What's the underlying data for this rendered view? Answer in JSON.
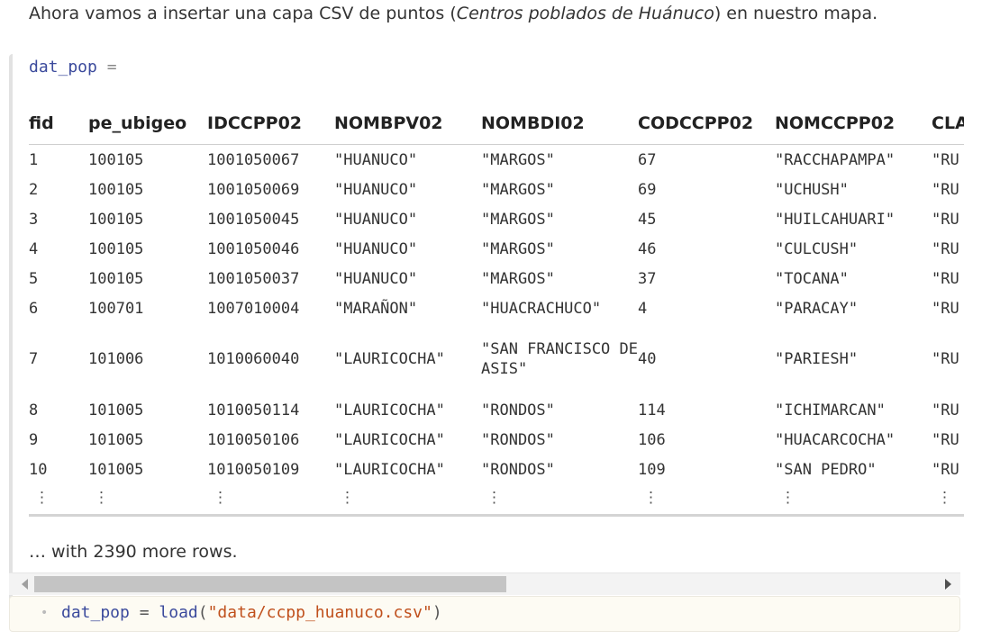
{
  "intro": {
    "before": "Ahora vamos a insertar una capa CSV de puntos (",
    "emph": "Centros poblados de Huánuco",
    "after": ") en nuestro mapa."
  },
  "cell": {
    "variable": "dat_pop",
    "operator": "="
  },
  "table": {
    "headers": [
      "fid",
      "pe_ubigeo",
      "IDCCPP02",
      "NOMBPV02",
      "NOMBDI02",
      "CODCCPP02",
      "NOMCCPP02",
      "CLA"
    ],
    "rows": [
      [
        "1",
        "100105",
        "1001050067",
        "\"HUANUCO\"",
        "\"MARGOS\"",
        "67",
        "\"RACCHAPAMPA\"",
        "\"RU"
      ],
      [
        "2",
        "100105",
        "1001050069",
        "\"HUANUCO\"",
        "\"MARGOS\"",
        "69",
        "\"UCHUSH\"",
        "\"RU"
      ],
      [
        "3",
        "100105",
        "1001050045",
        "\"HUANUCO\"",
        "\"MARGOS\"",
        "45",
        "\"HUILCAHUARI\"",
        "\"RU"
      ],
      [
        "4",
        "100105",
        "1001050046",
        "\"HUANUCO\"",
        "\"MARGOS\"",
        "46",
        "\"CULCUSH\"",
        "\"RU"
      ],
      [
        "5",
        "100105",
        "1001050037",
        "\"HUANUCO\"",
        "\"MARGOS\"",
        "37",
        "\"TOCANA\"",
        "\"RU"
      ],
      [
        "6",
        "100701",
        "1007010004",
        "\"MARAÑON\"",
        "\"HUACRACHUCO\"",
        "4",
        "\"PARACAY\"",
        "\"RU"
      ],
      [
        "7",
        "101006",
        "1010060040",
        "\"LAURICOCHA\"",
        "\"SAN FRANCISCO DE ASIS\"",
        "40",
        "\"PARIESH\"",
        "\"RU"
      ],
      [
        "8",
        "101005",
        "1010050114",
        "\"LAURICOCHA\"",
        "\"RONDOS\"",
        "114",
        "\"ICHIMARCAN\"",
        "\"RU"
      ],
      [
        "9",
        "101005",
        "1010050106",
        "\"LAURICOCHA\"",
        "\"RONDOS\"",
        "106",
        "\"HUACARCOCHA\"",
        "\"RU"
      ],
      [
        "10",
        "101005",
        "1010050109",
        "\"LAURICOCHA\"",
        "\"RONDOS\"",
        "109",
        "\"SAN PEDRO\"",
        "\"RU"
      ]
    ],
    "ellipsis": "⋮",
    "more_rows": "… with 2390 more rows."
  },
  "code": {
    "bullet": "•",
    "var": "dat_pop",
    "op": "=",
    "fn": "load",
    "open": "(",
    "arg": "\"data/ccpp_huanuco.csv\"",
    "close": ")"
  }
}
